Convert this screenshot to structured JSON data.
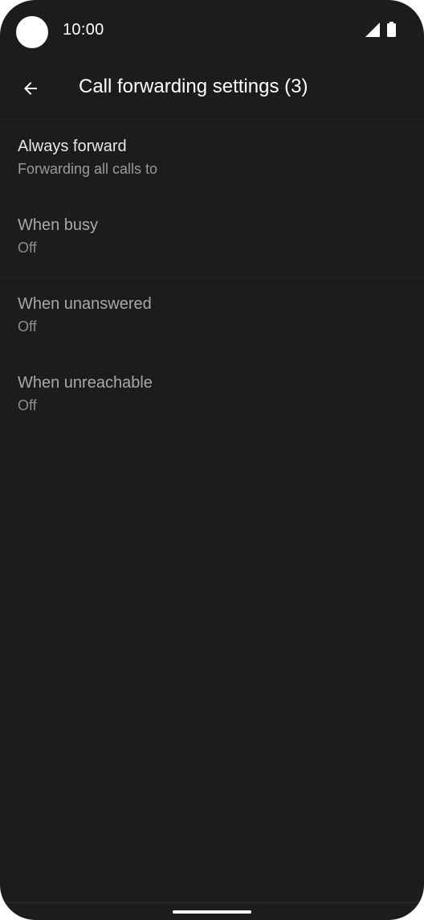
{
  "status_bar": {
    "time": "10:00",
    "icons": [
      "camera-cutout",
      "signal-icon",
      "battery-icon"
    ]
  },
  "app_bar": {
    "back_icon": "arrow-back-icon",
    "title": "Call forwarding settings (3)"
  },
  "preferences": [
    {
      "title": "Always forward",
      "summary": "Forwarding all calls to",
      "state": "enabled"
    },
    {
      "title": "When busy",
      "summary": "Off",
      "state": "disabled"
    },
    {
      "title": "When unanswered",
      "summary": "Off",
      "state": "disabled"
    },
    {
      "title": "When unreachable",
      "summary": "Off",
      "state": "disabled"
    }
  ],
  "colors": {
    "background": "#1c1c1c",
    "primary_text": "#e8e8e8",
    "secondary_text": "#9a9a9a",
    "disabled_text": "#a8a8a8"
  }
}
